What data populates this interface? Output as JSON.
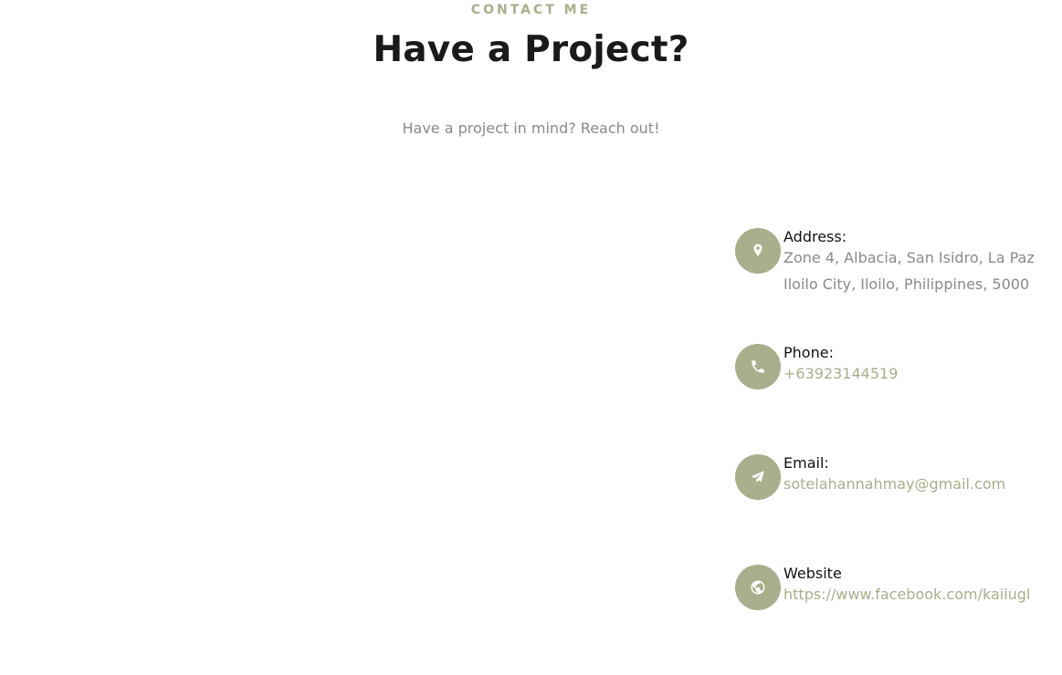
{
  "header": {
    "eyebrow": "CONTACT ME",
    "title": "Have a Project?",
    "subtitle": "Have a project in mind? Reach out!"
  },
  "contact": {
    "address": {
      "label": "Address:",
      "line1": "Zone 4, Albacia, San Isidro, La Paz",
      "line2": "Iloilo City, Iloilo, Philippines, 5000",
      "icon": "map-pin-icon"
    },
    "phone": {
      "label": "Phone:",
      "value": "+63923144519",
      "icon": "phone-icon"
    },
    "email": {
      "label": "Email:",
      "value": "sotelahannahmay@gmail.com",
      "icon": "paper-plane-icon"
    },
    "website": {
      "label": "Website",
      "value": "https://www.facebook.com/kaiiugl",
      "icon": "globe-icon"
    }
  },
  "colors": {
    "accent": "#aaae8c",
    "heading": "#1a1a1a",
    "muted": "#8a8a8a"
  }
}
